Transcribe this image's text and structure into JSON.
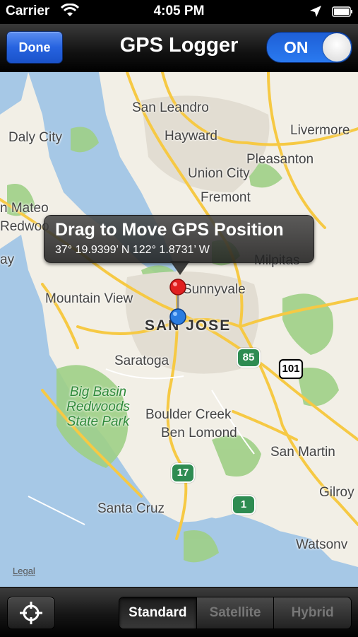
{
  "status_bar": {
    "carrier": "Carrier",
    "time": "4:05 PM"
  },
  "nav_bar": {
    "done_label": "Done",
    "title": "GPS Logger",
    "toggle_label": "ON",
    "toggle_state": true
  },
  "map": {
    "places": {
      "san_leandro": "San Leandro",
      "livermore": "Livermore",
      "daly_city": "Daly City",
      "hayward": "Hayward",
      "pleasanton": "Pleasanton",
      "union_city": "Union City",
      "fremont": "Fremont",
      "san_mateo": "n Mateo",
      "redwood": "Redwoo",
      "milpitas": "Milpitas",
      "mountain_view": "Mountain View",
      "sunnyvale": "Sunnyvale",
      "san_jose": "SAN JOSE",
      "saratoga": "Saratoga",
      "big_basin": "Big Basin",
      "redwoods": "Redwoods",
      "state_park": "State Park",
      "boulder_creek": "Boulder Creek",
      "ben_lomond": "Ben Lomond",
      "san_martin": "San Martin",
      "gilroy": "Gilroy",
      "santa_cruz": "Santa Cruz",
      "watsonville": "Watsonv",
      "ay": "ay"
    },
    "highways": {
      "hwy85": "85",
      "us101": "101",
      "hwy17": "17",
      "hwy1": "1"
    },
    "legal": "Legal",
    "callout": {
      "title": "Drag to Move GPS Position",
      "subtitle": "37° 19.9399’ N 122° 1.8731’ W"
    }
  },
  "toolbar": {
    "segments": [
      "Standard",
      "Satellite",
      "Hybrid"
    ],
    "selected_segment": "Standard"
  },
  "colors": {
    "accent_blue": "#2663e0",
    "map_land": "#f2efe6",
    "water": "#a6c8e6",
    "park": "#9fcf86",
    "road": "#f6c944"
  }
}
